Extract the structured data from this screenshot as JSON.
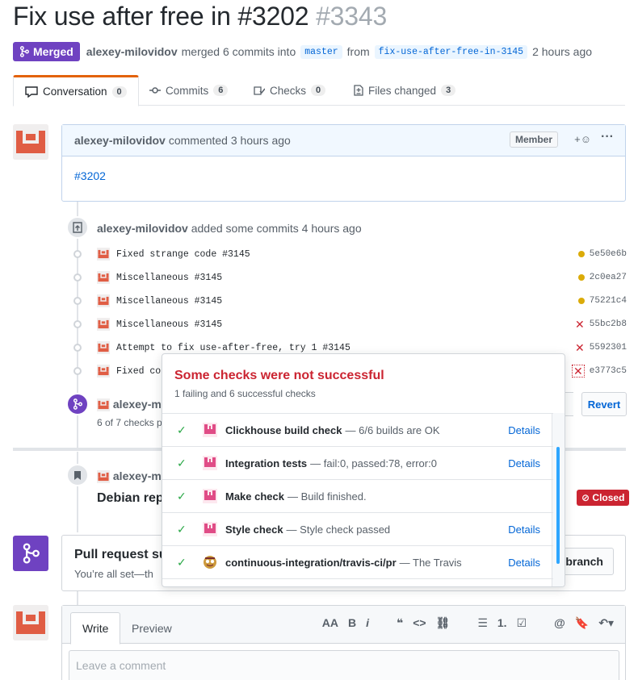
{
  "pr": {
    "title": "Fix use after free in #3202",
    "number": "#3343",
    "status": "Merged",
    "author": "alexey-milovidov",
    "merge_text": "merged 6 commits into",
    "base_branch": "master",
    "from_text": "from",
    "head_branch": "fix-use-after-free-in-3145",
    "time": "2 hours ago"
  },
  "tabs": [
    {
      "label": "Conversation",
      "count": "0"
    },
    {
      "label": "Commits",
      "count": "6"
    },
    {
      "label": "Checks",
      "count": "0"
    },
    {
      "label": "Files changed",
      "count": "3"
    }
  ],
  "comment": {
    "author": "alexey-milovidov",
    "action": "commented 3 hours ago",
    "badge": "Member",
    "reaction": "+☺",
    "menu": "···",
    "body": "#3202"
  },
  "commit_event": {
    "author": "alexey-milovidov",
    "text": "added some commits 4 hours ago"
  },
  "commits": [
    {
      "message": "Fixed strange code #3145",
      "sha": "5e50e6b",
      "status": "pending"
    },
    {
      "message": "Miscellaneous #3145",
      "sha": "2c0ea27",
      "status": "pending"
    },
    {
      "message": "Miscellaneous #3145",
      "sha": "75221c4",
      "status": "pending"
    },
    {
      "message": "Miscellaneous #3145",
      "sha": "55bc2b8",
      "status": "failed"
    },
    {
      "message": "Attempt to fix use-after-free, try 1 #3145",
      "sha": "5592301",
      "status": "failed"
    },
    {
      "message": "Fixed co",
      "sha": "e3773c5",
      "status": "failed"
    }
  ],
  "merge_event": {
    "author": "alexey-m",
    "checks_text": "6 of 7 checks p",
    "revert_label": "Revert"
  },
  "ref_event": {
    "author": "alexey-m",
    "title": "Debian rep",
    "closed_label": "Closed"
  },
  "merge_box": {
    "title": "Pull request su",
    "subtitle": "You’re all set—th",
    "button_label": "branch"
  },
  "editor": {
    "write_tab": "Write",
    "preview_tab": "Preview",
    "placeholder": "Leave a comment",
    "toolbar": [
      "AA",
      "B",
      "i",
      "❝",
      "<>",
      "⛓",
      "☰",
      "1.",
      "☑",
      "@",
      "🔖",
      "↶▾"
    ]
  },
  "popover": {
    "title": "Some checks were not successful",
    "subtitle": "1 failing and 6 successful checks",
    "checks": [
      {
        "name": "Clickhouse build check",
        "desc": "— 6/6 builds are OK",
        "details": "Details",
        "icon": "ch-app-icon"
      },
      {
        "name": "Integration tests",
        "desc": "— fail:0, passed:78, error:0",
        "details": "Details",
        "icon": "ch-app-icon"
      },
      {
        "name": "Make check",
        "desc": "— Build finished.",
        "details": "",
        "icon": "ch-app-icon"
      },
      {
        "name": "Style check",
        "desc": "— Style check passed",
        "details": "Details",
        "icon": "ch-app-icon"
      },
      {
        "name": "continuous-integration/travis-ci/pr",
        "desc": "— The Travis",
        "details": "Details",
        "icon": "travis-icon"
      }
    ]
  },
  "colors": {
    "merged_purple": "#6f42c1",
    "link_blue": "#0366d6",
    "fail_red": "#cb2431",
    "success_green": "#28a745",
    "pending_yellow": "#dbab09",
    "avatar_red": "#e05d44"
  }
}
